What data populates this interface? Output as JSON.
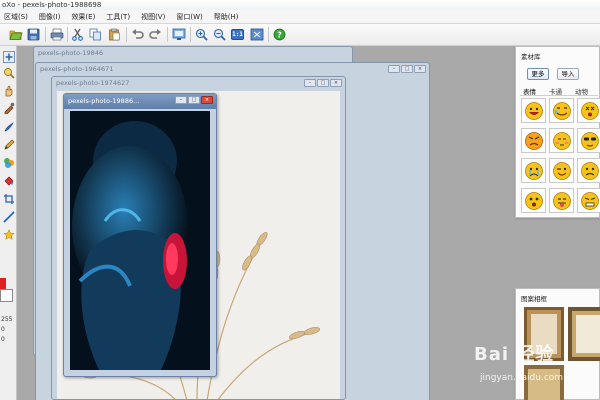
{
  "app": {
    "title": "oXo - pexels-photo-1988698"
  },
  "menu": {
    "items": [
      "区域(S)",
      "图像(I)",
      "效果(E)",
      "工具(T)",
      "视图(V)",
      "窗口(W)",
      "帮助(H)"
    ]
  },
  "toolbar": {
    "icons": [
      "open-icon",
      "save-icon",
      "print-icon",
      "cut-icon",
      "copy-icon",
      "paste-icon",
      "undo-icon",
      "redo-icon",
      "screen-capture-icon",
      "zoom-in-icon",
      "zoom-out-icon",
      "actual-size-icon",
      "fit-window-icon",
      "help-icon"
    ],
    "actual_size_label": "1:1"
  },
  "tools": {
    "icons": [
      "add-icon",
      "magnifier-icon",
      "pan-hand-icon",
      "color-picker-icon",
      "brush-icon",
      "pencil-icon",
      "clone-stamp-icon",
      "paint-bucket-icon",
      "crop-icon",
      "line-icon",
      "star-icon"
    ],
    "fg_color": "#e02020",
    "bg_color": "#ffffff",
    "values": [
      "255",
      "0",
      "0"
    ]
  },
  "windows": [
    {
      "title": "pexels-photo-19846"
    },
    {
      "title": "pexels-photo-1964671"
    },
    {
      "title": "pexels-photo-1974627"
    },
    {
      "title": "pexels-photo-19886..."
    }
  ],
  "library": {
    "title": "素材库",
    "more_button": "更多",
    "import_button": "导入",
    "tabs": [
      "表情",
      "卡通",
      "动物"
    ],
    "emojis": [
      "laugh",
      "cry-laugh",
      "dizzy",
      "angry",
      "shy",
      "cool",
      "cry",
      "wink",
      "sad",
      "surprised",
      "tongue",
      "mad"
    ]
  },
  "frames": {
    "title": "图案相框"
  },
  "watermark": {
    "brand": "Bai 经验",
    "url": "jingyan.baidu.com"
  },
  "colors": {
    "accent": "#3c73c9",
    "workspace": "#a9a9a9"
  }
}
